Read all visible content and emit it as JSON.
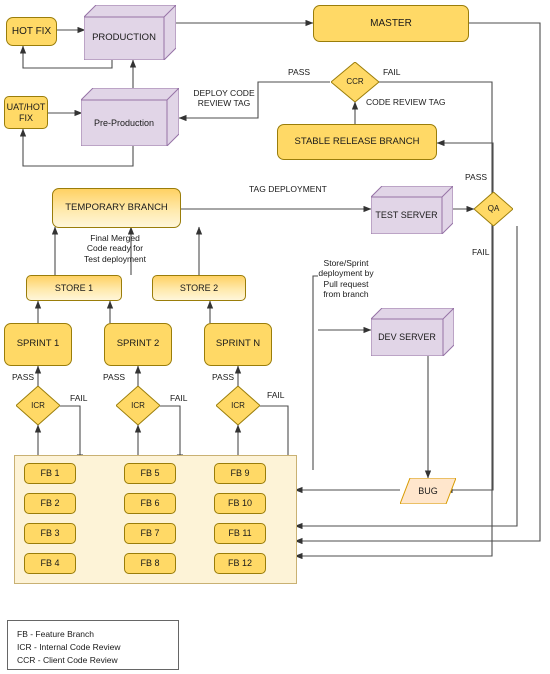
{
  "diagram": {
    "title": "Git branching and CI/CD deployment workflow",
    "colors": {
      "yellow_fill": "#ffd966",
      "yellow_stroke": "#9a7d0a",
      "purple_fill": "#e1d5e7",
      "purple_stroke": "#9673a6",
      "container_fill": "#fdf3d7",
      "container_stroke": "#c9b173",
      "bug_fill": "#ffe6cc",
      "bug_stroke": "#d79b00",
      "edge_stroke": "#4d4d4d"
    }
  },
  "nodes": {
    "hot_fix": "HOT FIX",
    "production": "PRODUCTION",
    "master": "MASTER",
    "uat_hot_fix": "UAT/HOT\nFIX",
    "pre_production": "Pre-Production",
    "ccr": "CCR",
    "stable_release_branch": "STABLE RELEASE BRANCH",
    "temporary_branch": "TEMPORARY BRANCH",
    "test_server": "TEST SERVER",
    "qa": "QA",
    "store_1": "STORE 1",
    "store_2": "STORE 2",
    "dev_server": "DEV SERVER",
    "sprint_1": "SPRINT 1",
    "sprint_2": "SPRINT 2",
    "sprint_n": "SPRINT N",
    "icr_1": "ICR",
    "icr_2": "ICR",
    "icr_3": "ICR",
    "bug": "BUG"
  },
  "feature_branches": {
    "column_1": [
      "FB 1",
      "FB 2",
      "FB 3",
      "FB 4"
    ],
    "column_2": [
      "FB 5",
      "FB 6",
      "FB 7",
      "FB 8"
    ],
    "column_3": [
      "FB 9",
      "FB 10",
      "FB 11",
      "FB 12"
    ]
  },
  "edge_labels": {
    "deploy_code_review_tag": "DEPLOY CODE\nREVIEW TAG",
    "ccr_pass": "PASS",
    "ccr_fail": "FAIL",
    "code_review_tag": "CODE REVIEW TAG",
    "tag_deployment": "TAG DEPLOYMENT",
    "qa_pass": "PASS",
    "qa_fail": "FAIL",
    "final_merged": "Final Merged\nCode ready for\nTest deployment",
    "store_sprint_deploy": "Store/Sprint\ndeployment by\nPull request\nfrom branch",
    "icr1_pass": "PASS",
    "icr1_fail": "FAIL",
    "icr2_pass": "PASS",
    "icr2_fail": "FAIL",
    "icr3_pass": "PASS",
    "icr3_fail": "FAIL"
  },
  "legend": {
    "lines": [
      "FB - Feature Branch",
      "ICR - Internal Code Review",
      "CCR - Client Code Review"
    ]
  }
}
